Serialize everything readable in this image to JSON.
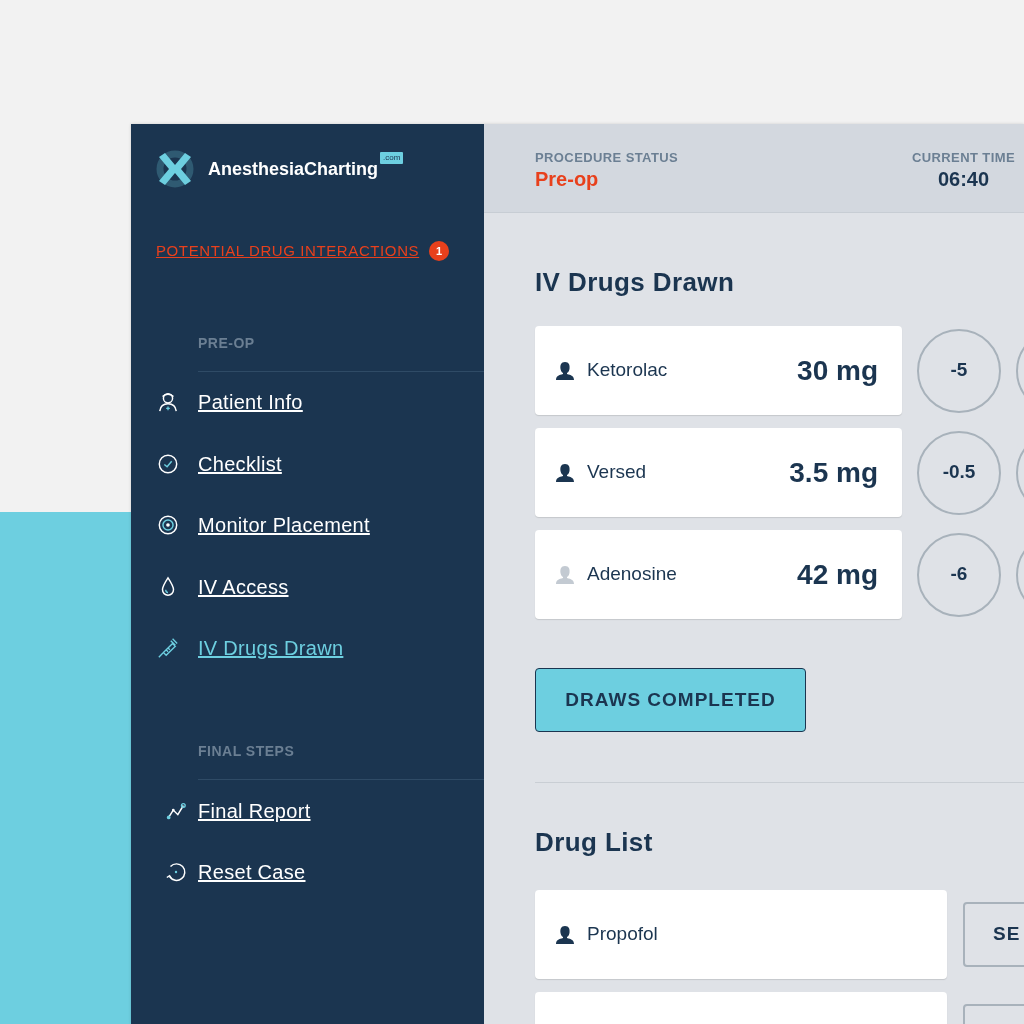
{
  "logo": {
    "name": "AnesthesiaCharting",
    "suffix": ".com"
  },
  "alert": {
    "label": "POTENTIAL DRUG INTERACTIONS",
    "count": "1"
  },
  "sidebar": [
    {
      "heading": "PRE-OP",
      "items": [
        {
          "label": "Patient Info",
          "selected": false
        },
        {
          "label": "Checklist",
          "selected": false
        },
        {
          "label": "Monitor Placement",
          "selected": false
        },
        {
          "label": "IV Access",
          "selected": false
        },
        {
          "label": "IV Drugs Drawn",
          "selected": true
        }
      ]
    },
    {
      "heading": "FINAL STEPS",
      "items": [
        {
          "label": "Final Report",
          "selected": false
        },
        {
          "label": "Reset Case",
          "selected": false
        }
      ]
    }
  ],
  "header": {
    "status_label": "PROCEDURE STATUS",
    "status": "Pre-op",
    "time_label": "CURRENT TIME",
    "time": "06:40"
  },
  "drawn": {
    "title": "IV Drugs Drawn",
    "rows": [
      {
        "name": "Ketorolac",
        "dose": "30 mg",
        "step": "-5",
        "dimmed": false
      },
      {
        "name": "Versed",
        "dose": "3.5 mg",
        "step": "-0.5",
        "dimmed": false
      },
      {
        "name": "Adenosine",
        "dose": "42 mg",
        "step": "-6",
        "dimmed": true
      }
    ],
    "button": "DRAWS COMPLETED"
  },
  "drug_list": {
    "title": "Drug List",
    "rows": [
      {
        "name": "Propofol",
        "dimmed": false,
        "button": "SE"
      }
    ]
  }
}
